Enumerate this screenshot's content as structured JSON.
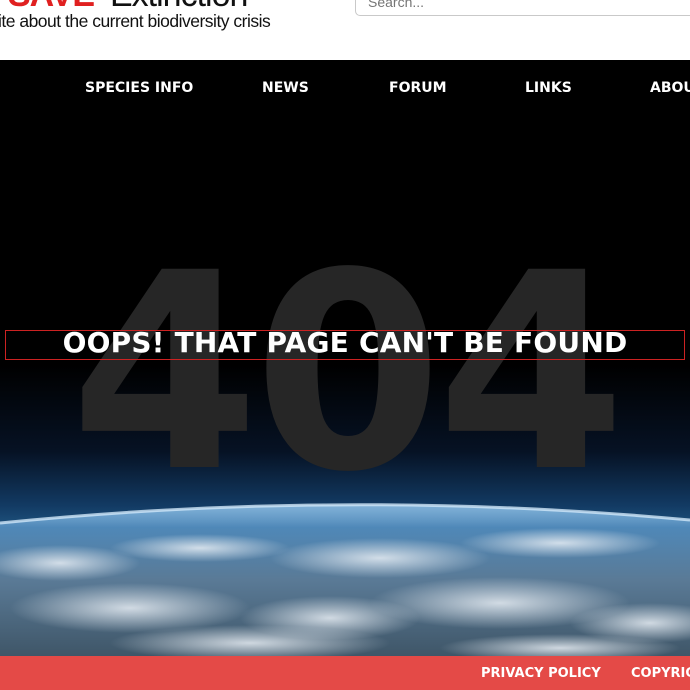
{
  "header": {
    "logo_text": "Extinction",
    "tagline": "ite about the current biodiversity crisis",
    "search_placeholder": "Search..."
  },
  "nav": {
    "items": [
      {
        "label": "SPECIES INFO"
      },
      {
        "label": "NEWS"
      },
      {
        "label": "FORUM"
      },
      {
        "label": "LINKS"
      },
      {
        "label": "ABOU"
      }
    ]
  },
  "hero": {
    "code": "404",
    "title": "OOPS! THAT PAGE CAN'T BE FOUND"
  },
  "footer": {
    "links": [
      {
        "label": "PRIVACY POLICY"
      },
      {
        "label": "COPYRIG"
      }
    ]
  },
  "colors": {
    "footer_bg": "#e44a47",
    "logo_red": "#e02020",
    "title_box_border": "#cc2222"
  }
}
